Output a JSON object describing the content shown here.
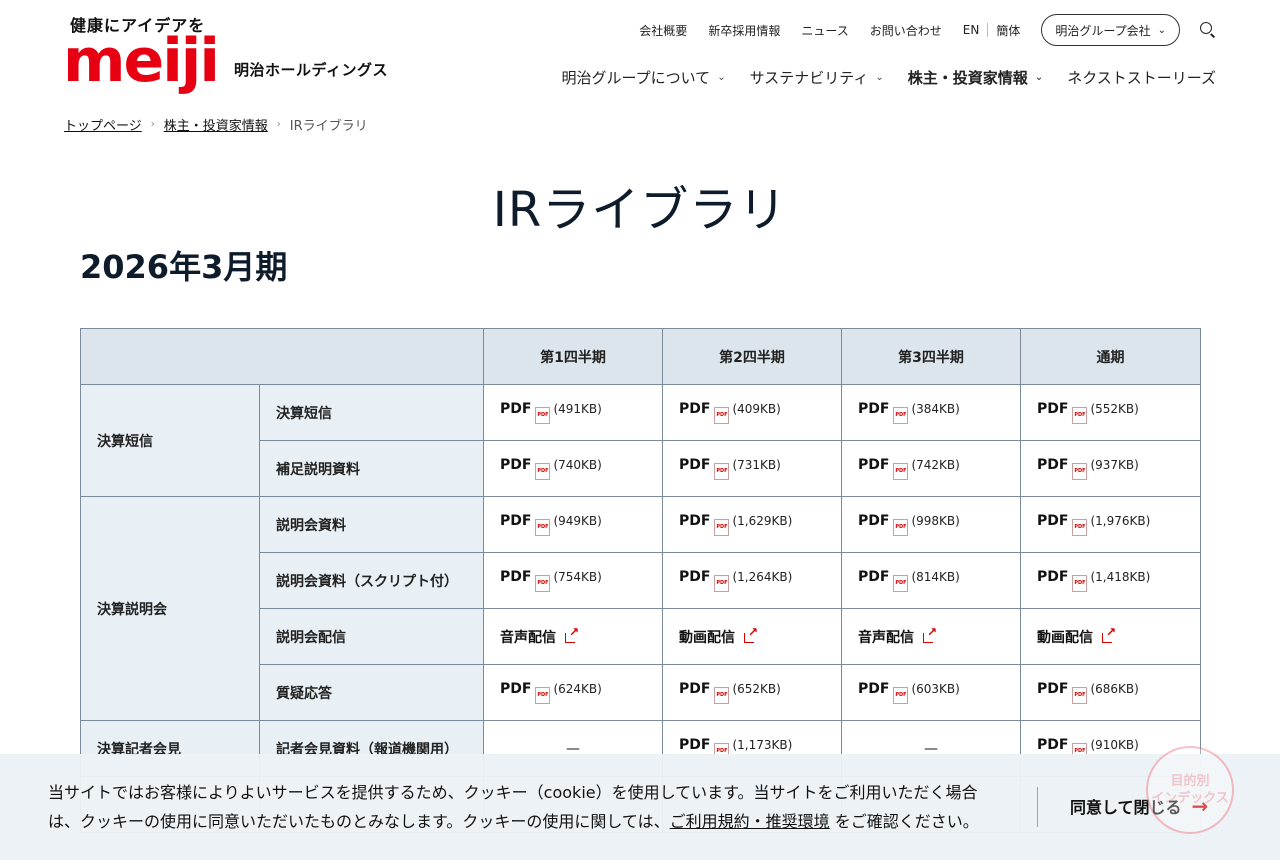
{
  "logo": {
    "tagline": "健康にアイデアを",
    "wordmark": "meiji",
    "company": "明治ホールディングス"
  },
  "utility_nav": {
    "links": [
      "会社概要",
      "新卒採用情報",
      "ニュース",
      "お問い合わせ"
    ],
    "lang_en": "EN",
    "lang_zh": "簡体",
    "group_button": "明治グループ会社"
  },
  "main_nav": {
    "items": [
      "明治グループについて",
      "サステナビリティ",
      "株主・投資家情報",
      "ネクストストーリーズ"
    ]
  },
  "breadcrumb": {
    "home": "トップページ",
    "parent": "株主・投資家情報",
    "current": "IRライブラリ"
  },
  "page": {
    "title": "IRライブラリ",
    "section": "2026年3月期"
  },
  "table": {
    "headers": [
      "第1四半期",
      "第2四半期",
      "第3四半期",
      "通期"
    ],
    "pdf": "PDF",
    "pdf_icon_text": "PDF",
    "dash": "—",
    "categories": {
      "tanshin": "決算短信",
      "setsumeikai": "決算説明会",
      "kisha": "決算記者会見"
    },
    "rows": [
      {
        "label": "決算短信",
        "sizes": [
          "(491KB)",
          "(409KB)",
          "(384KB)",
          "(552KB)"
        ]
      },
      {
        "label": "補足説明資料",
        "sizes": [
          "(740KB)",
          "(731KB)",
          "(742KB)",
          "(937KB)"
        ]
      },
      {
        "label": "説明会資料",
        "sizes": [
          "(949KB)",
          "(1,629KB)",
          "(998KB)",
          "(1,976KB)"
        ]
      },
      {
        "label": "説明会資料（スクリプト付）",
        "sizes": [
          "(754KB)",
          "(1,264KB)",
          "(814KB)",
          "(1,418KB)"
        ]
      },
      {
        "label": "説明会配信",
        "media": [
          "音声配信",
          "動画配信",
          "音声配信",
          "動画配信"
        ]
      },
      {
        "label": "質疑応答",
        "sizes": [
          "(624KB)",
          "(652KB)",
          "(603KB)",
          "(686KB)"
        ]
      },
      {
        "label": "記者会見資料（報道機関用）",
        "sizes": [
          "",
          "(1,173KB)",
          "",
          "(910KB)"
        ]
      }
    ]
  },
  "cookie": {
    "text_before": "当サイトではお客様によりよいサービスを提供するため、クッキー（cookie）を使用しています。当サイトをご利用いただく場合は、クッキーの使用に同意いただいたものとみなします。クッキーの使用に関しては、",
    "link": "ご利用規約・推奨環境",
    "text_after": " をご確認ください。",
    "accept": "同意して閉じる"
  },
  "purpose_index": {
    "line1": "目的別",
    "line2": "インデックス"
  },
  "colors": {
    "brand_red": "#e60012",
    "header_bg": "#dde5ec",
    "label_bg": "#e9f0f5",
    "border": "#7a8a9a"
  }
}
